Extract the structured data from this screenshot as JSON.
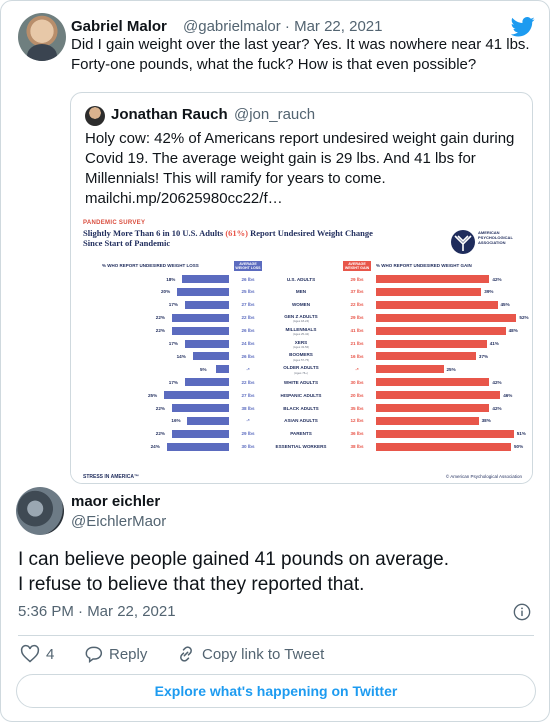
{
  "outer_tweet": {
    "author_name": "Gabriel Malor",
    "handle_date": "@gabrielmalor · Mar 22, 2021",
    "text": "Did I gain weight over the last year? Yes. It was nowhere near 41 lbs. Forty-one pounds, what the fuck? How is that even possible?"
  },
  "quoted_tweet": {
    "author_name": "Jonathan Rauch",
    "handle": "@jon_rauch",
    "text": "Holy cow: 42% of Americans report undesired weight gain during Covid 19. The average weight gain is 29 lbs. And 41 lbs for Millennials! This will ramify for years to come. mailchi.mp/20625980cc22/f…"
  },
  "infographic": {
    "kicker": "PANDEMIC SURVEY",
    "headline_part1": "Slightly More Than 6 in 10 U.S. Adults ",
    "headline_highlight": "(61%)",
    "headline_part2": " Report Undesired Weight Change Since Start of Pandemic",
    "logo_text": "AMERICAN PSYCHOLOGICAL ASSOCIATION",
    "left_col_head": "% WHO REPORT UNDESIRED WEIGHT LOSS",
    "left_box_head": "AVERAGE WEIGHT LOSS",
    "right_box_head": "AVERAGE WEIGHT GAIN",
    "right_col_head": "% WHO REPORT UNDESIRED WEIGHT GAIN",
    "footer_left": "STRESS IN AMERICA™",
    "footer_right": "© American Psychological Association",
    "loss_color": "#5b6bbf",
    "gain_color": "#e8564a",
    "rows": [
      {
        "label": "U.S. ADULTS",
        "sub": "",
        "loss_pct": "18%",
        "loss": 18,
        "loss_lbs": "26 lbs",
        "gain_lbs": "29 lbs",
        "gain_pct": "42%",
        "gain": 42
      },
      {
        "label": "MEN",
        "sub": "",
        "loss_pct": "20%",
        "loss": 20,
        "loss_lbs": "25 lbs",
        "gain_lbs": "37 lbs",
        "gain_pct": "39%",
        "gain": 39
      },
      {
        "label": "WOMEN",
        "sub": "",
        "loss_pct": "17%",
        "loss": 17,
        "loss_lbs": "27 lbs",
        "gain_lbs": "22 lbs",
        "gain_pct": "45%",
        "gain": 45
      },
      {
        "label": "GEN Z ADULTS",
        "sub": "(Ages 18-24)",
        "loss_pct": "22%",
        "loss": 22,
        "loss_lbs": "22 lbs",
        "gain_lbs": "29 lbs",
        "gain_pct": "52%",
        "gain": 52
      },
      {
        "label": "MILLENNIALS",
        "sub": "(Ages 25-42)",
        "loss_pct": "22%",
        "loss": 22,
        "loss_lbs": "26 lbs",
        "gain_lbs": "41 lbs",
        "gain_pct": "48%",
        "gain": 48
      },
      {
        "label": "XERS",
        "sub": "(Ages 43-56)",
        "loss_pct": "17%",
        "loss": 17,
        "loss_lbs": "24 lbs",
        "gain_lbs": "21 lbs",
        "gain_pct": "41%",
        "gain": 41
      },
      {
        "label": "BOOMERS",
        "sub": "(Ages 57-75)",
        "loss_pct": "14%",
        "loss": 14,
        "loss_lbs": "26 lbs",
        "gain_lbs": "16 lbs",
        "gain_pct": "37%",
        "gain": 37
      },
      {
        "label": "OLDER ADULTS",
        "sub": "(Ages 76+)",
        "loss_pct": "5%",
        "loss": 5,
        "loss_lbs": "-*",
        "gain_lbs": "-*",
        "gain_pct": "25%",
        "gain": 25
      },
      {
        "label": "WHITE ADULTS",
        "sub": "",
        "loss_pct": "17%",
        "loss": 17,
        "loss_lbs": "22 lbs",
        "gain_lbs": "30 lbs",
        "gain_pct": "42%",
        "gain": 42
      },
      {
        "label": "HISPANIC ADULTS",
        "sub": "",
        "loss_pct": "25%",
        "loss": 25,
        "loss_lbs": "27 lbs",
        "gain_lbs": "20 lbs",
        "gain_pct": "46%",
        "gain": 46
      },
      {
        "label": "BLACK ADULTS",
        "sub": "",
        "loss_pct": "22%",
        "loss": 22,
        "loss_lbs": "38 lbs",
        "gain_lbs": "35 lbs",
        "gain_pct": "42%",
        "gain": 42
      },
      {
        "label": "ASIAN ADULTS",
        "sub": "",
        "loss_pct": "16%",
        "loss": 16,
        "loss_lbs": "-*",
        "gain_lbs": "12 lbs",
        "gain_pct": "38%",
        "gain": 38
      },
      {
        "label": "PARENTS",
        "sub": "",
        "loss_pct": "22%",
        "loss": 22,
        "loss_lbs": "29 lbs",
        "gain_lbs": "36 lbs",
        "gain_pct": "51%",
        "gain": 51
      },
      {
        "label": "ESSENTIAL WORKERS",
        "sub": "",
        "loss_pct": "24%",
        "loss": 24,
        "loss_lbs": "30 lbs",
        "gain_lbs": "38 lbs",
        "gain_pct": "50%",
        "gain": 50
      }
    ]
  },
  "reply": {
    "author_name": "maor eichler",
    "handle": "@EichlerMaor",
    "text_line1": "I can believe people gained 41 pounds on average.",
    "text_line2": "I refuse to believe that they reported that.",
    "timestamp": "5:36 PM · Mar 22, 2021",
    "likes": "4",
    "reply_label": "Reply",
    "copy_label": "Copy link to Tweet",
    "explore_label": "Explore what's happening on Twitter"
  },
  "colors": {
    "twitter_blue": "#1d9bf0",
    "gray_text": "#536471"
  }
}
